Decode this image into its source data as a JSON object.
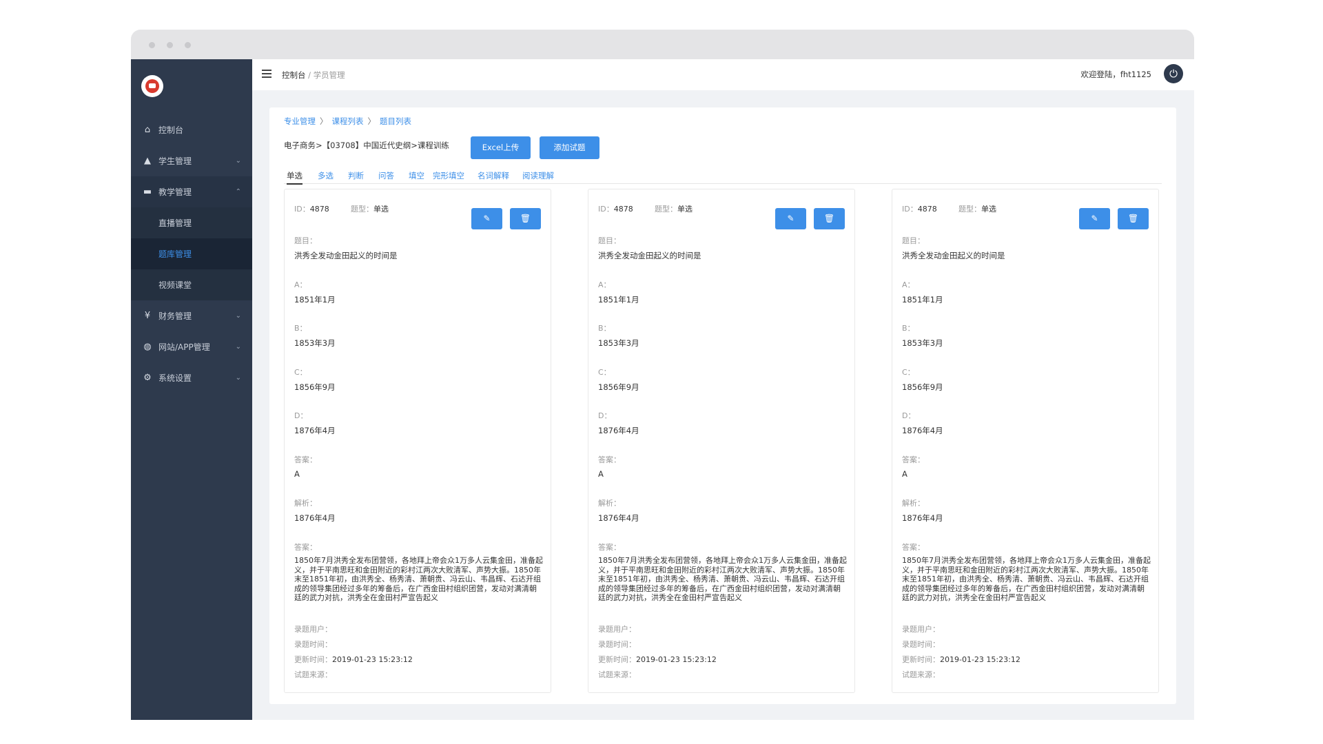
{
  "sidebar": {
    "items": [
      {
        "label": "控制台",
        "icon": "home-icon"
      },
      {
        "label": "学生管理",
        "icon": "graduation-cap-icon"
      },
      {
        "label": "教学管理",
        "icon": "book-icon"
      },
      {
        "label": "直播管理"
      },
      {
        "label": "题库管理"
      },
      {
        "label": "视频课堂"
      },
      {
        "label": "财务管理",
        "icon": "finance-icon"
      },
      {
        "label": "网站/APP管理",
        "icon": "globe-icon"
      },
      {
        "label": "系统设置",
        "icon": "gear-icon"
      }
    ]
  },
  "topbar": {
    "crumb_home": "控制台",
    "crumb_sep": "/",
    "crumb_current": "学员管理",
    "welcome": "欢迎登陆，fht1125"
  },
  "panel": {
    "breadcrumb": [
      "专业管理",
      "课程列表",
      "题目列表"
    ],
    "path": "电子商务>【03708】中国近代史纲>课程训练",
    "excel_button": "Excel上传",
    "add_button": "添加试题",
    "tabs": [
      "单选",
      "多选",
      "判断",
      "问答",
      "填空",
      "完形填空",
      "名词解释",
      "阅读理解"
    ]
  },
  "labels": {
    "id": "ID：",
    "type": "题型：",
    "question": "题目：",
    "a": "A：",
    "b": "B：",
    "c": "C：",
    "d": "D：",
    "answer": "答案：",
    "analysis": "解析：",
    "answer2": "答案：",
    "entry_user": "录题用户：",
    "entry_time": "录题时间：",
    "update_time": "更新时间：",
    "source": "试题来源："
  },
  "cards": [
    {
      "id": "4878",
      "type": "单选",
      "question": "洪秀全发动金田起义的时间是",
      "a": "1851年1月",
      "b": "1853年3月",
      "c": "1856年9月",
      "d": "1876年4月",
      "answer": "A",
      "analysis": "1876年4月",
      "detail": "1850年7月洪秀全发布团营领，各地拜上帝会众1万多人云集金田，准备起义，并于平南思旺和金田附近的彩村江两次大败清军、声势大振。1850年末至1851年初，由洪秀全、杨秀清、萧朝贵、冯云山、韦昌辉、石达开组成的领导集团经过多年的筹备后，在广西金田村组织团营，发动对满清朝廷的武力对抗，洪秀全在金田村严宣告起义",
      "update_time": "2019-01-23  15:23:12"
    },
    {
      "id": "4878",
      "type": "单选",
      "question": "洪秀全发动金田起义的时间是",
      "a": "1851年1月",
      "b": "1853年3月",
      "c": "1856年9月",
      "d": "1876年4月",
      "answer": "A",
      "analysis": "1876年4月",
      "detail": "1850年7月洪秀全发布团营领，各地拜上帝会众1万多人云集金田，准备起义，并于平南思旺和金田附近的彩村江两次大败清军、声势大振。1850年末至1851年初，由洪秀全、杨秀清、萧朝贵、冯云山、韦昌辉、石达开组成的领导集团经过多年的筹备后，在广西金田村组织团营，发动对满清朝廷的武力对抗，洪秀全在金田村严宣告起义",
      "update_time": "2019-01-23  15:23:12"
    },
    {
      "id": "4878",
      "type": "单选",
      "question": "洪秀全发动金田起义的时间是",
      "a": "1851年1月",
      "b": "1853年3月",
      "c": "1856年9月",
      "d": "1876年4月",
      "answer": "A",
      "analysis": "1876年4月",
      "detail": "1850年7月洪秀全发布团营领，各地拜上帝会众1万多人云集金田，准备起义，并于平南思旺和金田附近的彩村江两次大败清军、声势大振。1850年末至1851年初，由洪秀全、杨秀清、萧朝贵、冯云山、韦昌辉、石达开组成的领导集团经过多年的筹备后，在广西金田村组织团营，发动对满清朝廷的武力对抗，洪秀全在金田村严宣告起义",
      "update_time": "2019-01-23  15:23:12"
    }
  ],
  "colors": {
    "accent": "#3d8fe8",
    "sidebar": "#2e3a4d",
    "active_sub": "#1a2535"
  }
}
